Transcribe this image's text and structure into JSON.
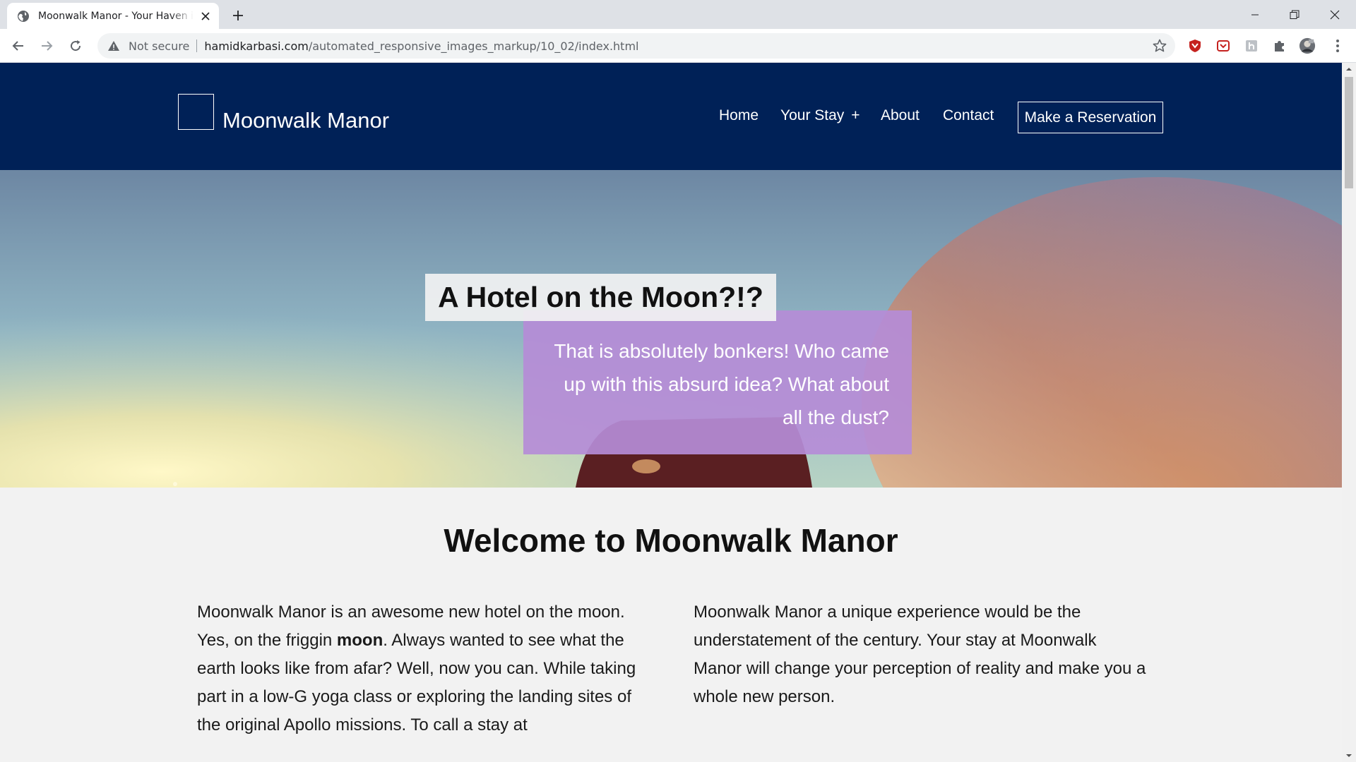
{
  "browser": {
    "tab_title": "Moonwalk Manor - Your Haven in Space",
    "security_label": "Not secure",
    "url_domain": "hamidkarbasi.com",
    "url_path": "/automated_responsive_images_markup/10_02/index.html"
  },
  "site": {
    "title": "Moonwalk Manor",
    "nav": {
      "home": "Home",
      "your_stay": "Your Stay",
      "your_stay_expand": "+",
      "about": "About",
      "contact": "Contact"
    },
    "reserve_label": "Make a Reservation"
  },
  "hero": {
    "title": "A Hotel on the Moon?!?",
    "subtitle": "That is absolutely bonkers! Who came up with this absurd idea? What about all the dust?"
  },
  "main": {
    "heading": "Welcome to Moonwalk Manor",
    "left_part1": "Moonwalk Manor is an awesome new hotel on the moon. Yes, on the friggin ",
    "left_bold": "moon",
    "left_part2": ". Always wanted to see what the earth looks like from afar? Well, now you can. While taking part in a low-G yoga class or exploring the landing sites of the original Apollo missions. To call a stay at",
    "right_text": "Moonwalk Manor a unique experience would be the understatement of the century. Your stay at Moonwalk Manor will change your perception of reality and make you a whole new person."
  },
  "colors": {
    "header_bg": "#002157",
    "hero_subtitle_bg": "#b58cd7",
    "page_bg": "#f2f2f2"
  }
}
